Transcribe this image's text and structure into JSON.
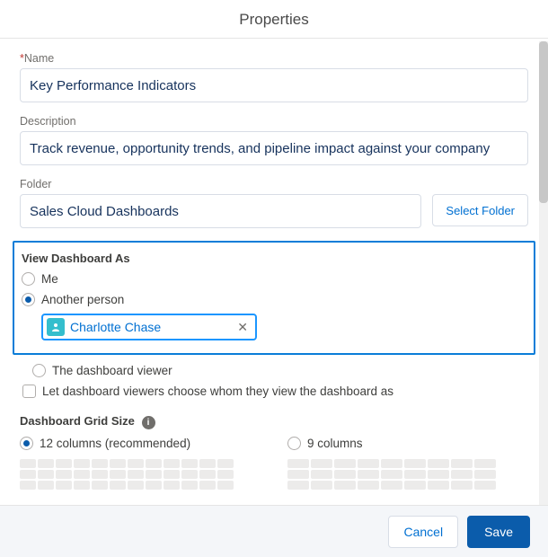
{
  "dialog": {
    "title": "Properties"
  },
  "name": {
    "label": "Name",
    "value": "Key Performance Indicators",
    "required": "*"
  },
  "description": {
    "label": "Description",
    "value": "Track revenue, opportunity trends, and pipeline impact against your company"
  },
  "folder": {
    "label": "Folder",
    "value": "Sales Cloud Dashboards",
    "select_btn": "Select Folder"
  },
  "view_as": {
    "section_label": "View Dashboard As",
    "options": {
      "me": "Me",
      "another": "Another person",
      "viewer": "The dashboard viewer"
    },
    "selected": "another",
    "person": "Charlotte Chase",
    "let_viewers": "Let dashboard viewers choose whom they view the dashboard as"
  },
  "grid": {
    "section_label": "Dashboard Grid Size",
    "options": {
      "c12": "12 columns (recommended)",
      "c9": "9 columns"
    },
    "selected": "c12"
  },
  "footer": {
    "cancel": "Cancel",
    "save": "Save"
  }
}
